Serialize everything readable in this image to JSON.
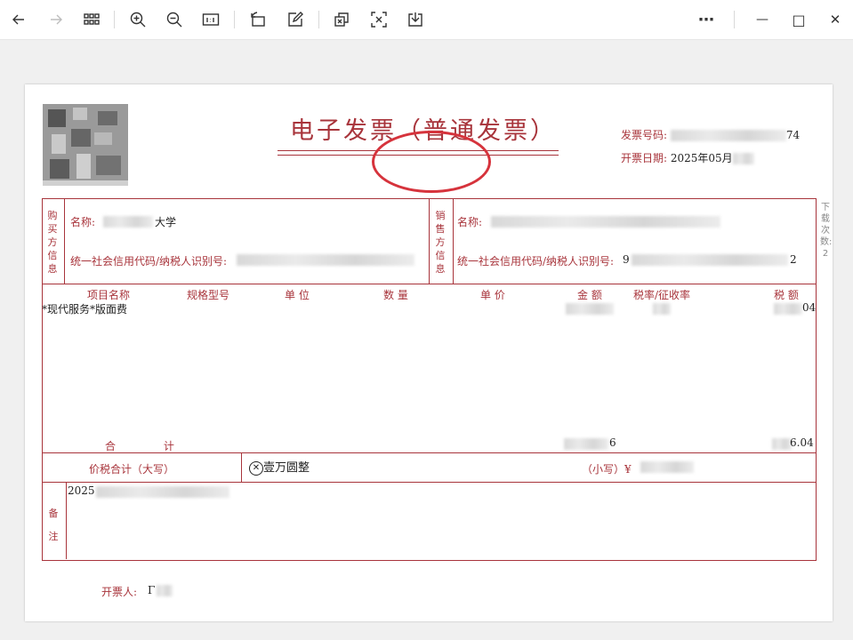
{
  "toolbar": {
    "back": "back-icon",
    "forward": "forward-icon",
    "more": "⋯",
    "minimize": "—",
    "maximize": "□",
    "close": "✕"
  },
  "invoice": {
    "title": "电子发票（普通发票）",
    "number_label": "发票号码:",
    "number_suffix": "74",
    "date_label": "开票日期:",
    "date_value": "2025年05月",
    "buyer_section": "购买方信息",
    "seller_section": "销售方信息",
    "buyer_name_label": "名称:",
    "buyer_name_value": "大学",
    "buyer_id_label": "统一社会信用代码/纳税人识别号:",
    "seller_name_label": "名称:",
    "seller_id_label": "统一社会信用代码/纳税人识别号:",
    "seller_id_prefix": "9",
    "seller_id_suffix": "2",
    "download_note": "下载次数: 2",
    "columns": [
      "项目名称",
      "规格型号",
      "单 位",
      "数 量",
      "单 价",
      "金 额",
      "税率/征收率",
      "税 额"
    ],
    "item_name": "*现代服务*版面费",
    "item_tax_suffix": "04",
    "total_label": "合 计",
    "total_amount_suffix": "6",
    "total_tax_suffix": "6.04",
    "sum_label": "价税合计（大写）",
    "sum_upper": "壹万圆整",
    "sum_small_label": "（小写）¥",
    "remark_label": "备注",
    "remark_value": "2025",
    "issuer_label": "开票人:",
    "issuer_value": "Γ"
  },
  "colors": {
    "accent": "#a8343b",
    "stamp": "#d6333c"
  }
}
